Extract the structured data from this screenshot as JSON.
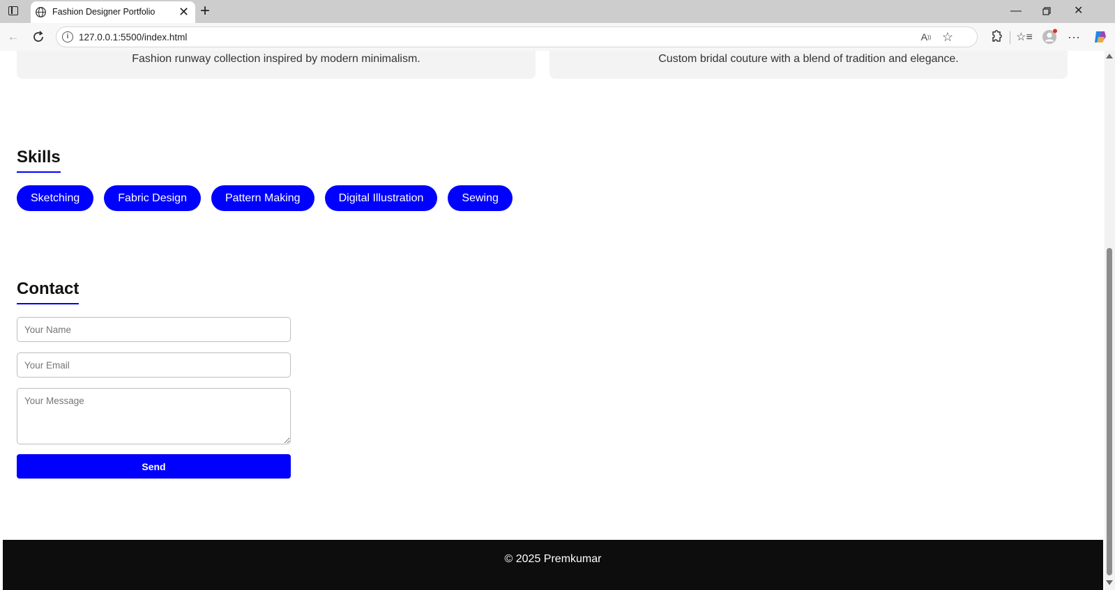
{
  "browser": {
    "tab_title": "Fashion Designer Portfolio",
    "url": "127.0.0.1:5500/index.html"
  },
  "projects": [
    {
      "description": "Fashion runway collection inspired by modern minimalism."
    },
    {
      "description": "Custom bridal couture with a blend of tradition and elegance."
    }
  ],
  "skills": {
    "title": "Skills",
    "items": [
      "Sketching",
      "Fabric Design",
      "Pattern Making",
      "Digital Illustration",
      "Sewing"
    ]
  },
  "contact": {
    "title": "Contact",
    "name_placeholder": "Your Name",
    "email_placeholder": "Your Email",
    "message_placeholder": "Your Message",
    "send_label": "Send"
  },
  "footer": {
    "text": "© 2025 Premkumar"
  },
  "colors": {
    "accent": "#0000ff",
    "footer_bg": "#0d0d0d",
    "card_bg": "#f3f3f3"
  }
}
